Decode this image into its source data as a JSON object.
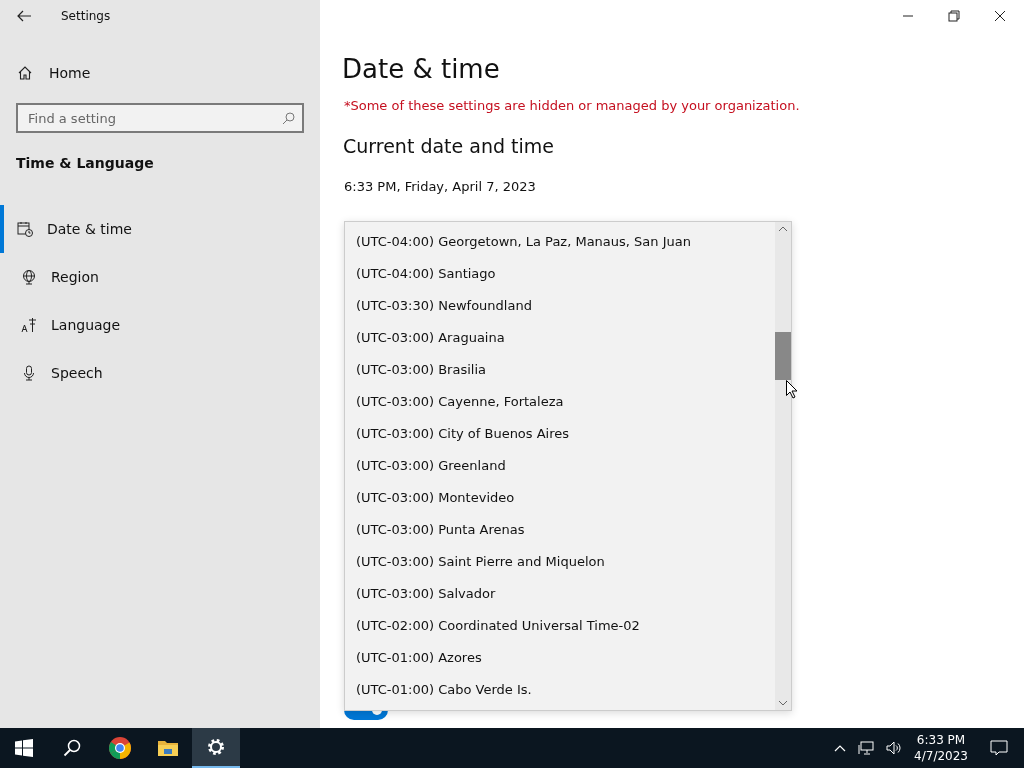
{
  "window": {
    "title": "Settings"
  },
  "sidebar": {
    "home": "Home",
    "search": {
      "placeholder": "Find a setting"
    },
    "section": "Time & Language",
    "items": [
      {
        "label": "Date & time",
        "kind": "calendar",
        "selected": true
      },
      {
        "label": "Region",
        "kind": "globe",
        "selected": false
      },
      {
        "label": "Language",
        "kind": "language",
        "selected": false
      },
      {
        "label": "Speech",
        "kind": "mic",
        "selected": false
      }
    ]
  },
  "page": {
    "title": "Date & time",
    "warning": "*Some of these settings are hidden or managed by your organization.",
    "heading": "Current date and time",
    "datetime": "6:33 PM, Friday, April 7, 2023",
    "toggle": {
      "on": true
    }
  },
  "timezone_list": {
    "options": [
      {
        "label": "(UTC-04:00) Georgetown, La Paz, Manaus, San Juan",
        "selected": false
      },
      {
        "label": "(UTC-04:00) Santiago",
        "selected": false
      },
      {
        "label": "(UTC-03:30) Newfoundland",
        "selected": false
      },
      {
        "label": "(UTC-03:00) Araguaina",
        "selected": false
      },
      {
        "label": "(UTC-03:00) Brasilia",
        "selected": false
      },
      {
        "label": "(UTC-03:00) Cayenne, Fortaleza",
        "selected": false
      },
      {
        "label": "(UTC-03:00) City of Buenos Aires",
        "selected": false
      },
      {
        "label": "(UTC-03:00) Greenland",
        "selected": false
      },
      {
        "label": "(UTC-03:00) Montevideo",
        "selected": false
      },
      {
        "label": "(UTC-03:00) Punta Arenas",
        "selected": false
      },
      {
        "label": "(UTC-03:00) Saint Pierre and Miquelon",
        "selected": false
      },
      {
        "label": "(UTC-03:00) Salvador",
        "selected": false
      },
      {
        "label": "(UTC-02:00) Coordinated Universal Time-02",
        "selected": false
      },
      {
        "label": "(UTC-01:00) Azores",
        "selected": false
      },
      {
        "label": "(UTC-01:00) Cabo Verde Is.",
        "selected": false
      }
    ]
  },
  "taskbar": {
    "apps": [
      {
        "kind": "start",
        "active": false
      },
      {
        "kind": "search",
        "active": false
      },
      {
        "kind": "chrome",
        "active": false
      },
      {
        "kind": "folder",
        "active": false
      },
      {
        "kind": "settings",
        "active": true
      }
    ],
    "time": "6:33 PM",
    "date": "4/7/2023"
  }
}
